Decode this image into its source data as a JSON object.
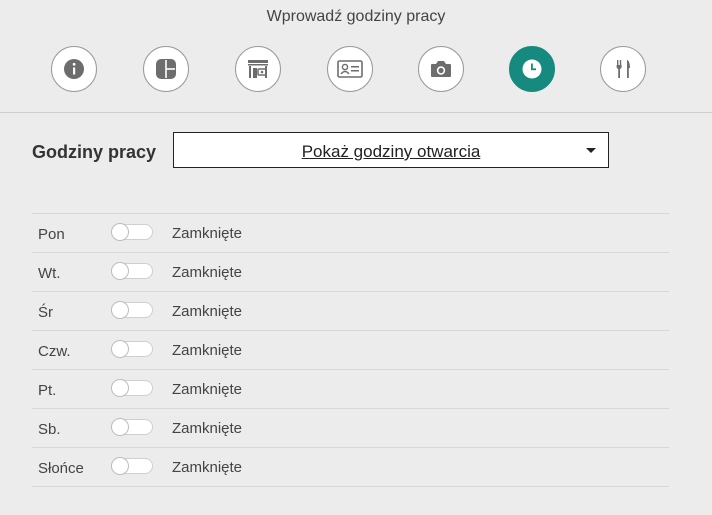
{
  "header": {
    "title": "Wprowadź godziny pracy"
  },
  "steps": [
    {
      "icon": "info-icon",
      "active": false
    },
    {
      "icon": "layout-icon",
      "active": false
    },
    {
      "icon": "storefront-icon",
      "active": false
    },
    {
      "icon": "contact-card-icon",
      "active": false
    },
    {
      "icon": "camera-icon",
      "active": false
    },
    {
      "icon": "clock-icon",
      "active": true
    },
    {
      "icon": "cutlery-icon",
      "active": false
    }
  ],
  "colors": {
    "accent": "#178a7f",
    "background": "#ececec"
  },
  "hours": {
    "label": "Godziny pracy",
    "dropdown_value": "Pokaż godziny otwarcia"
  },
  "days": [
    {
      "name": "Pon",
      "status": "Zamknięte",
      "open": false
    },
    {
      "name": "Wt.",
      "status": "Zamknięte",
      "open": false
    },
    {
      "name": "Śr",
      "status": "Zamknięte",
      "open": false
    },
    {
      "name": "Czw.",
      "status": "Zamknięte",
      "open": false
    },
    {
      "name": "Pt.",
      "status": "Zamknięte",
      "open": false
    },
    {
      "name": "Sb.",
      "status": "Zamknięte",
      "open": false
    },
    {
      "name": "Słońce",
      "status": "Zamknięte",
      "open": false
    }
  ]
}
